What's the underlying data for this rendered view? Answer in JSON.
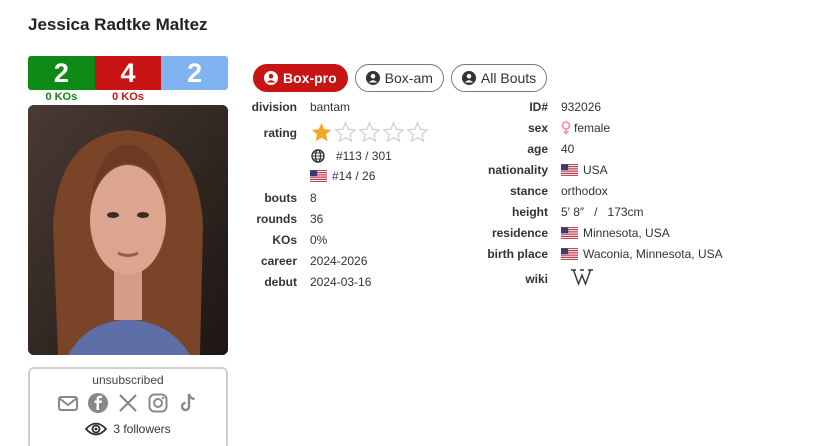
{
  "boxer": {
    "name": "Jessica Radtke Maltez"
  },
  "record": {
    "wins": "2",
    "losses": "4",
    "draws": "2",
    "win_kos": "0 KOs",
    "loss_kos": "0 KOs"
  },
  "tabs": [
    {
      "label": "Box-pro",
      "active": true
    },
    {
      "label": "Box-am",
      "active": false
    },
    {
      "label": "All Bouts",
      "active": false
    }
  ],
  "left_info": {
    "division": {
      "label": "division",
      "value": "bantam"
    },
    "rating": {
      "label": "rating",
      "stars": 1,
      "max_stars": 5
    },
    "world_rank": "#113 / 301",
    "country_rank": "#14 / 26",
    "bouts": {
      "label": "bouts",
      "value": "8"
    },
    "rounds": {
      "label": "rounds",
      "value": "36"
    },
    "kos": {
      "label": "KOs",
      "value": "0%"
    },
    "career": {
      "label": "career",
      "value": "2024-2026"
    },
    "debut": {
      "label": "debut",
      "value": "2024-03-16"
    }
  },
  "right_info": {
    "id": {
      "label": "ID#",
      "value": "932026"
    },
    "sex": {
      "label": "sex",
      "value": "female"
    },
    "age": {
      "label": "age",
      "value": "40"
    },
    "nationality": {
      "label": "nationality",
      "value": "USA"
    },
    "stance": {
      "label": "stance",
      "value": "orthodox"
    },
    "height": {
      "label": "height",
      "value": "5′ 8″   /   173cm"
    },
    "residence": {
      "label": "residence",
      "value": "Minnesota, USA"
    },
    "birth_place": {
      "label": "birth place",
      "value": "Waconia, Minnesota, USA"
    },
    "wiki": {
      "label": "wiki",
      "icon": "wikipedia-icon"
    }
  },
  "social": {
    "status": "unsubscribed",
    "followers": "3 followers"
  },
  "colors": {
    "win": "#0e8a16",
    "loss": "#c81414",
    "draw": "#80b4f0",
    "star": "#f5a623"
  }
}
